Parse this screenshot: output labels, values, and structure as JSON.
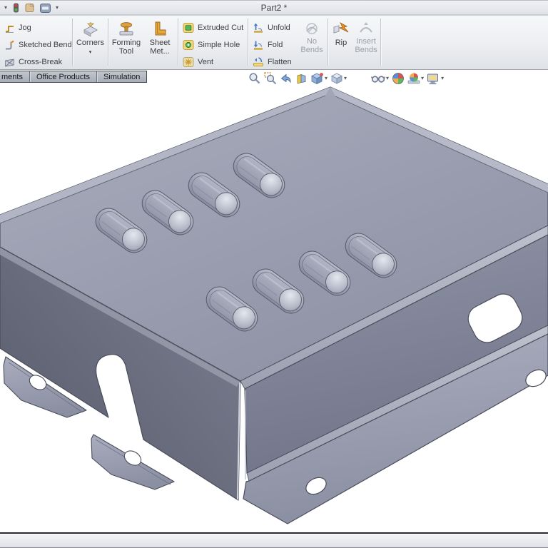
{
  "titlebar": {
    "title": "Part2 *"
  },
  "ribbon": {
    "bend_tools": [
      "Jog",
      "Sketched Bend",
      "Cross-Break"
    ],
    "corners_label": "Corners",
    "forming_tool": [
      "Forming",
      "Tool"
    ],
    "sheet_metal": [
      "Sheet",
      "Met..."
    ],
    "cut_tools": [
      "Extruded Cut",
      "Simple Hole",
      "Vent"
    ],
    "fold_tools": [
      "Unfold",
      "Fold",
      "Flatten"
    ],
    "no_bends": [
      "No",
      "Bends"
    ],
    "rip_label": "Rip",
    "insert_bends": [
      "Insert",
      "Bends"
    ]
  },
  "tabs": [
    "ments",
    "Office Products",
    "Simulation"
  ],
  "view_toolbar": {
    "icons": [
      "zoom-to-fit",
      "zoom-to-area",
      "previous-view",
      "section-view",
      "view-orientation",
      "display-style",
      "hide-show-items",
      "edit-appearance",
      "apply-scene",
      "view-settings"
    ]
  },
  "model": {
    "louver_count": 8,
    "flange_hole_count": 4,
    "face_colors": {
      "top": "#9a9eb0",
      "left_side": "#66697a",
      "front": "#82869a",
      "flange": "#9da1b3"
    },
    "background": "#ffffff"
  },
  "colors": {
    "ribbon_bg": "#eceef1",
    "tab_bg": "#b4b8c0",
    "disabled_text": "#9aa0a8",
    "outline": "#494c59"
  }
}
